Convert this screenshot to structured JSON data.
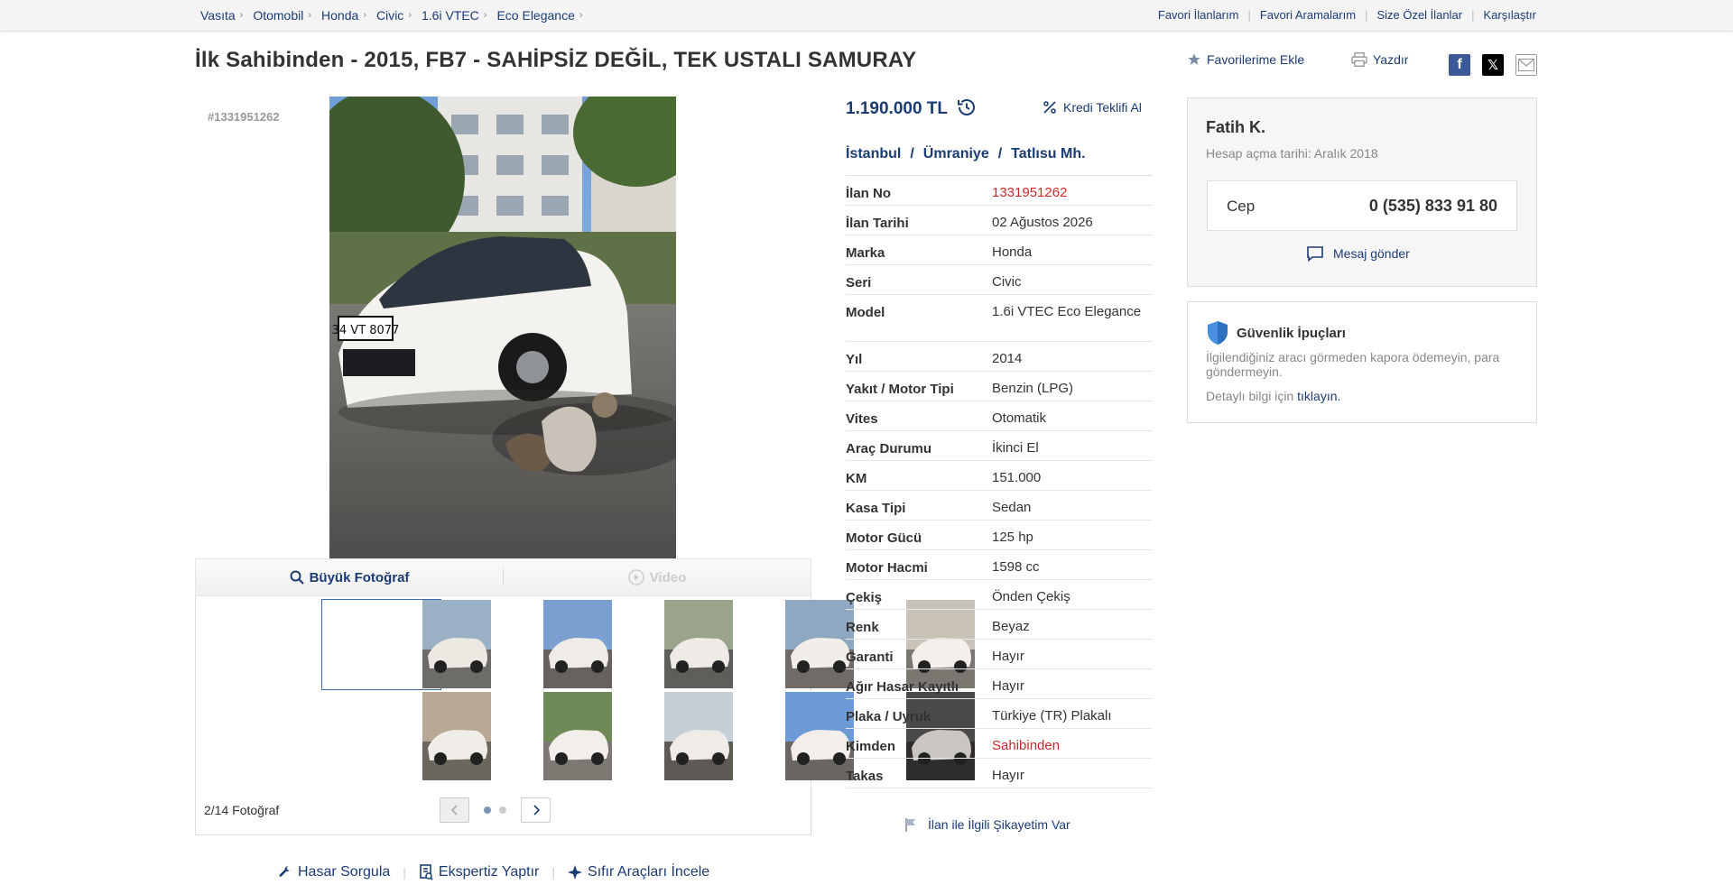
{
  "breadcrumb": [
    "Vasıta",
    "Otomobil",
    "Honda",
    "Civic",
    "1.6i VTEC",
    "Eco Elegance"
  ],
  "top_links": [
    "Favori İlanlarım",
    "Favori Aramalarım",
    "Size Özel İlanlar",
    "Karşılaştır"
  ],
  "title": "İlk Sahibinden - 2015, FB7 - SAHİPSİZ DEĞİL, TEK USTALI SAMURAY",
  "actions": {
    "favorite": "Favorilerime Ekle",
    "print": "Yazdır"
  },
  "social_icons": [
    "facebook-icon",
    "x-icon",
    "mail-icon"
  ],
  "gallery": {
    "ad_tag": "#1331951262",
    "big_photo": "Büyük Fotoğraf",
    "video": "Video",
    "count": "2/14 Fotoğraf",
    "selected_index": 2,
    "thumbnail_count": 10
  },
  "tools": [
    "Hasar Sorgula",
    "Ekspertiz Yaptır",
    "Sıfır Araçları İncele"
  ],
  "price": {
    "value": "1.190.000 TL",
    "loan": "Kredi Teklifi Al"
  },
  "location": [
    "İstanbul",
    "Ümraniye",
    "Tatlısu Mh."
  ],
  "specs": [
    {
      "k": "İlan No",
      "v": "1331951262",
      "red": true
    },
    {
      "k": "İlan Tarihi",
      "v": "02 Ağustos 2026"
    },
    {
      "k": "Marka",
      "v": "Honda"
    },
    {
      "k": "Seri",
      "v": "Civic"
    },
    {
      "k": "Model",
      "v": "1.6i VTEC Eco Elegance",
      "tall": true
    },
    {
      "k": "Yıl",
      "v": "2014"
    },
    {
      "k": "Yakıt / Motor Tipi",
      "v": "Benzin (LPG)"
    },
    {
      "k": "Vites",
      "v": "Otomatik"
    },
    {
      "k": "Araç Durumu",
      "v": "İkinci El"
    },
    {
      "k": "KM",
      "v": "151.000"
    },
    {
      "k": "Kasa Tipi",
      "v": "Sedan"
    },
    {
      "k": "Motor Gücü",
      "v": "125 hp"
    },
    {
      "k": "Motor Hacmi",
      "v": "1598 cc"
    },
    {
      "k": "Çekiş",
      "v": "Önden Çekiş"
    },
    {
      "k": "Renk",
      "v": "Beyaz"
    },
    {
      "k": "Garanti",
      "v": "Hayır"
    },
    {
      "k": "Ağır Hasar Kayıtlı",
      "v": "Hayır"
    },
    {
      "k": "Plaka / Uyruk",
      "v": "Türkiye (TR) Plakalı"
    },
    {
      "k": "Kimden",
      "v": "Sahibinden",
      "red": true
    },
    {
      "k": "Takas",
      "v": "Hayır"
    }
  ],
  "complaint": "İlan ile İlgili Şikayetim Var",
  "seller": {
    "name": "Fatih K.",
    "since": "Hesap açma tarihi: Aralık 2018",
    "phone_label": "Cep",
    "phone": "0 (535) 833 91 80",
    "message": "Mesaj gönder"
  },
  "safety": {
    "title": "Güvenlik İpuçları",
    "text": "İlgilendiğiniz aracı görmeden kapora ödemeyin, para göndermeyin.",
    "more_prefix": "Detaylı bilgi için",
    "more_link": "tıklayın."
  },
  "colors": {
    "link": "#1b3b73",
    "red": "#c92a2a",
    "border": "#dddddd"
  }
}
